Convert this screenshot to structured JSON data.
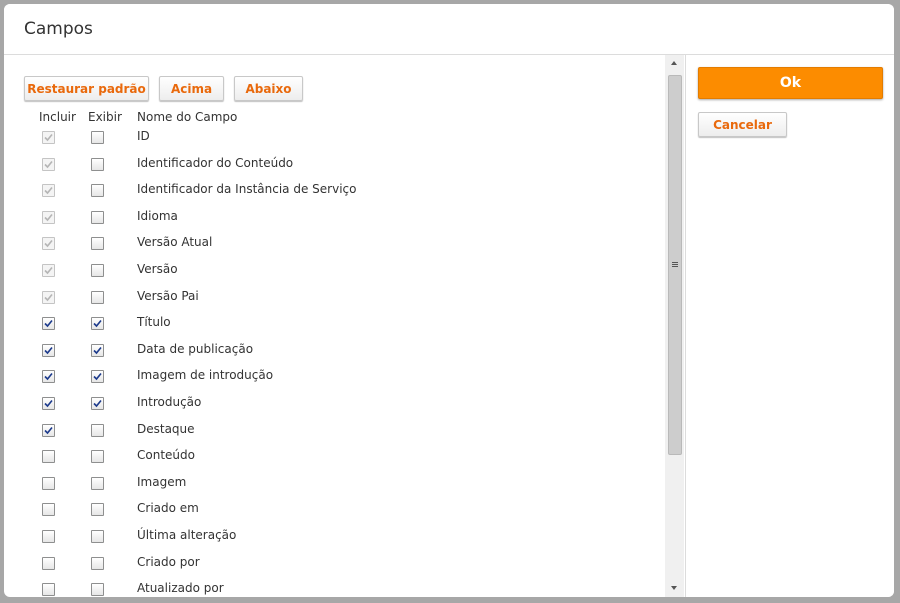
{
  "dialog": {
    "title": "Campos"
  },
  "toolbar": {
    "restore_label": "Restaurar padrão",
    "up_label": "Acima",
    "down_label": "Abaixo"
  },
  "columns": {
    "include": "Incluir",
    "display": "Exibir",
    "name": "Nome do Campo"
  },
  "fields": [
    {
      "name": "ID",
      "incluir": true,
      "incluir_disabled": true,
      "exibir": false
    },
    {
      "name": "Identificador do Conteúdo",
      "incluir": true,
      "incluir_disabled": true,
      "exibir": false
    },
    {
      "name": "Identificador da Instância de Serviço",
      "incluir": true,
      "incluir_disabled": true,
      "exibir": false
    },
    {
      "name": "Idioma",
      "incluir": true,
      "incluir_disabled": true,
      "exibir": false
    },
    {
      "name": "Versão Atual",
      "incluir": true,
      "incluir_disabled": true,
      "exibir": false
    },
    {
      "name": "Versão",
      "incluir": true,
      "incluir_disabled": true,
      "exibir": false
    },
    {
      "name": "Versão Pai",
      "incluir": true,
      "incluir_disabled": true,
      "exibir": false
    },
    {
      "name": "Título",
      "incluir": true,
      "incluir_disabled": false,
      "exibir": true
    },
    {
      "name": "Data de publicação",
      "incluir": true,
      "incluir_disabled": false,
      "exibir": true
    },
    {
      "name": "Imagem de introdução",
      "incluir": true,
      "incluir_disabled": false,
      "exibir": true
    },
    {
      "name": "Introdução",
      "incluir": true,
      "incluir_disabled": false,
      "exibir": true
    },
    {
      "name": "Destaque",
      "incluir": true,
      "incluir_disabled": false,
      "exibir": false
    },
    {
      "name": "Conteúdo",
      "incluir": false,
      "incluir_disabled": false,
      "exibir": false
    },
    {
      "name": "Imagem",
      "incluir": false,
      "incluir_disabled": false,
      "exibir": false
    },
    {
      "name": "Criado em",
      "incluir": false,
      "incluir_disabled": false,
      "exibir": false
    },
    {
      "name": "Última alteração",
      "incluir": false,
      "incluir_disabled": false,
      "exibir": false
    },
    {
      "name": "Criado por",
      "incluir": false,
      "incluir_disabled": false,
      "exibir": false
    },
    {
      "name": "Atualizado por",
      "incluir": false,
      "incluir_disabled": false,
      "exibir": false
    }
  ],
  "actions": {
    "ok_label": "Ok",
    "cancel_label": "Cancelar"
  },
  "colors": {
    "accent": "#fc8c00",
    "link_orange": "#e9690c",
    "check_blue": "#1c3a8c"
  }
}
